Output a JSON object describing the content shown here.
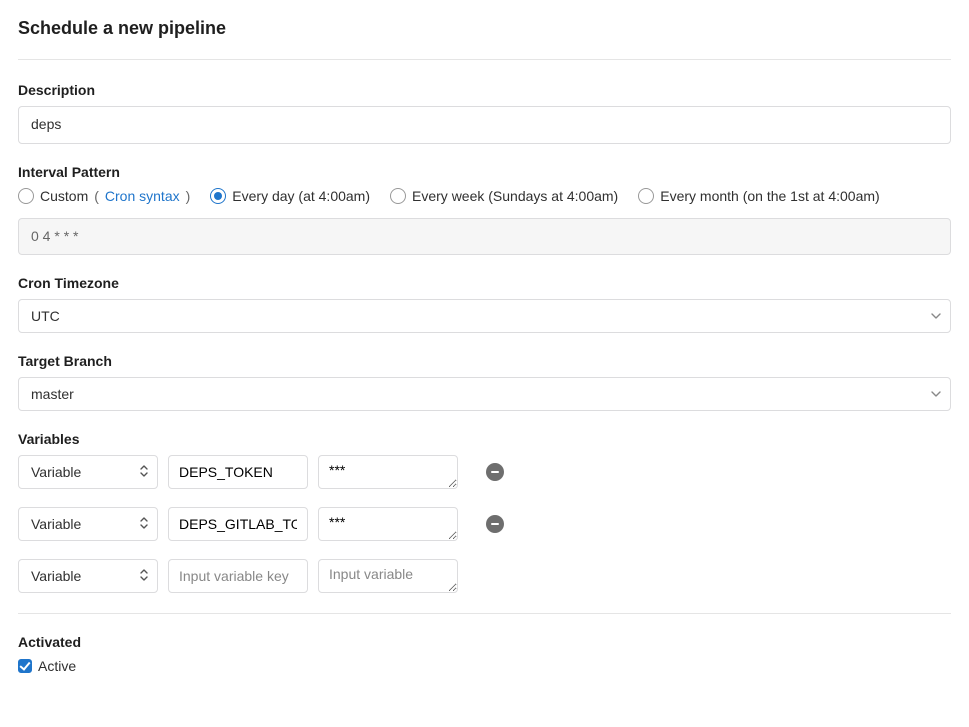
{
  "title": "Schedule a new pipeline",
  "description": {
    "label": "Description",
    "value": "deps"
  },
  "interval": {
    "label": "Interval Pattern",
    "options": {
      "custom": "Custom",
      "cron_syntax_link": "Cron syntax",
      "every_day": "Every day (at 4:00am)",
      "every_week": "Every week (Sundays at 4:00am)",
      "every_month": "Every month (on the 1st at 4:00am)"
    },
    "selected": "every_day",
    "cron_value": "0 4 * * *"
  },
  "timezone": {
    "label": "Cron Timezone",
    "value": "UTC"
  },
  "target": {
    "label": "Target Branch",
    "value": "master"
  },
  "variables": {
    "label": "Variables",
    "type_label": "Variable",
    "key_placeholder": "Input variable key",
    "value_placeholder": "Input variable",
    "rows": [
      {
        "key": "DEPS_TOKEN",
        "value": "***",
        "removable": true
      },
      {
        "key": "DEPS_GITLAB_TOKEN",
        "value": "***",
        "removable": true
      },
      {
        "key": "",
        "value": "",
        "removable": false
      }
    ]
  },
  "activated": {
    "label": "Activated",
    "checkbox_label": "Active",
    "checked": true
  }
}
